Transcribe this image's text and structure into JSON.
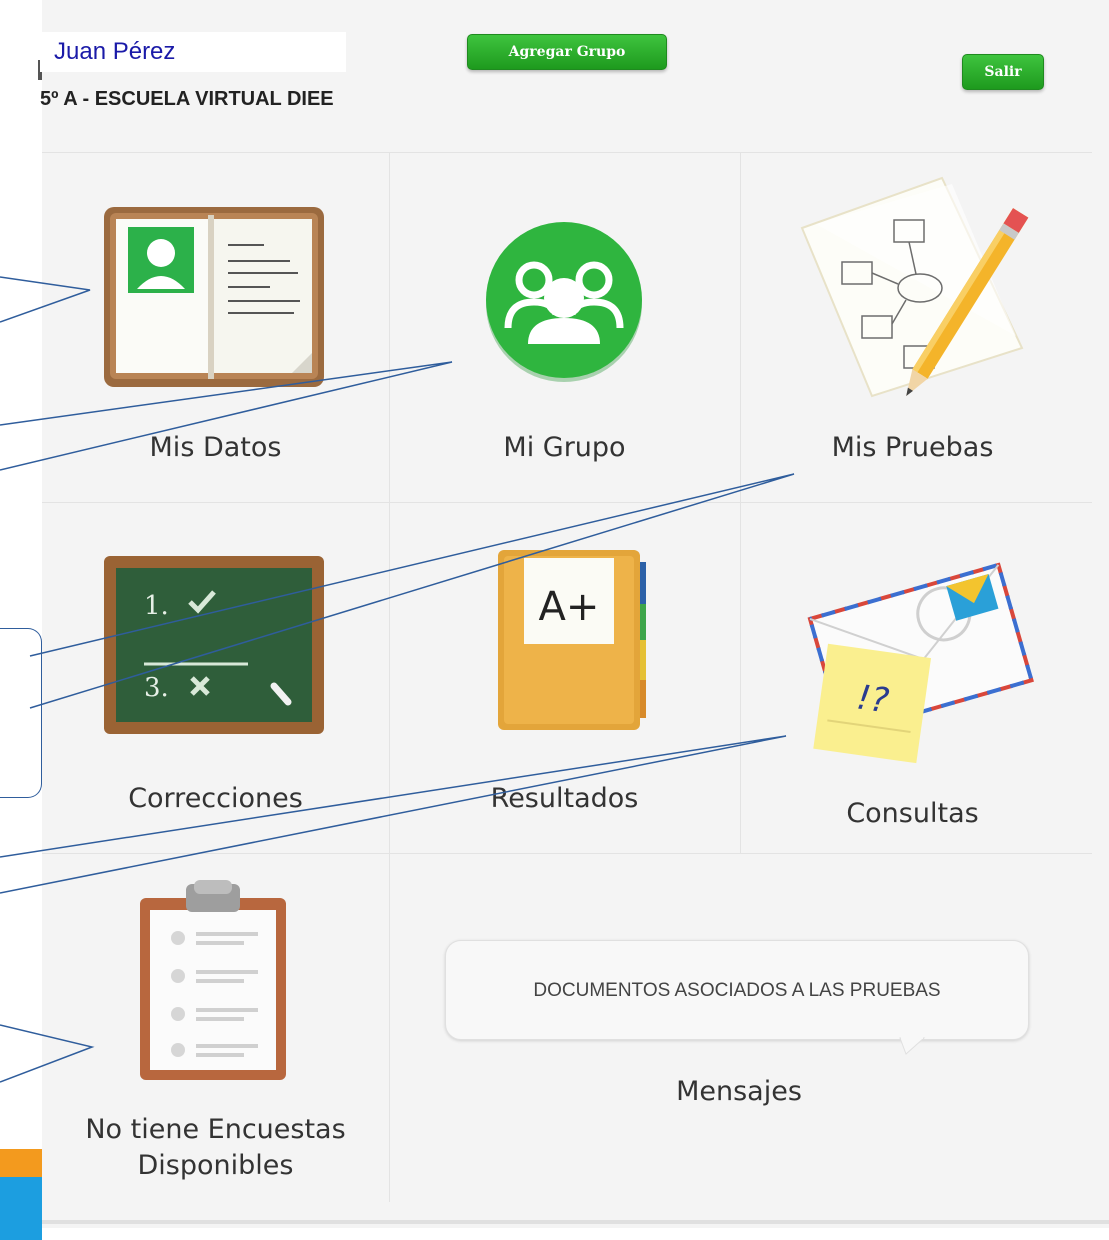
{
  "header": {
    "user_name": "Juan Pérez",
    "group_line": "5º A - ESCUELA VIRTUAL DIEE",
    "add_group_button": "Agregar Grupo",
    "logout_button": "Salir"
  },
  "tiles": {
    "mis_datos": "Mis Datos",
    "mi_grupo": "Mi Grupo",
    "mis_pruebas": "Mis Pruebas",
    "correcciones": "Correcciones",
    "resultados": "Resultados",
    "consultas": "Consultas",
    "encuestas_line1": "No tiene Encuestas",
    "encuestas_line2": "Disponibles",
    "documentos": "DOCUMENTOS ASOCIADOS A LAS PRUEBAS",
    "mensajes": "Mensajes"
  },
  "icon_text": {
    "board_line1": "1.",
    "board_line3": "3.",
    "folder_grade": "A+",
    "note_text": "!?"
  },
  "colors": {
    "button_green": "#2eb02e",
    "user_name_blue": "#1a1aa8",
    "callout_stroke": "#2f5d9c",
    "accent_orange": "#f39a1e",
    "accent_blue": "#1c9ee0"
  }
}
